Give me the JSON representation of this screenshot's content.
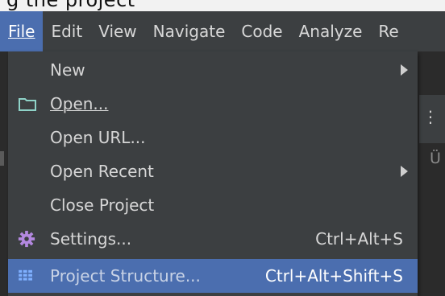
{
  "menubar": {
    "items": [
      {
        "label": "File",
        "active": true
      },
      {
        "label": "Edit"
      },
      {
        "label": "View"
      },
      {
        "label": "Navigate"
      },
      {
        "label": "Code"
      },
      {
        "label": "Analyze"
      },
      {
        "label": "Re"
      }
    ]
  },
  "background": {
    "top_cut_text": "g     the       project",
    "side_char": "Ü",
    "kebab": "⋮"
  },
  "file_menu": {
    "items": [
      {
        "label": "New",
        "submenu": true
      },
      {
        "label": "Open...",
        "icon": "folder-icon"
      },
      {
        "label": "Open URL..."
      },
      {
        "label": "Open Recent",
        "submenu": true
      },
      {
        "label": "Close Project"
      },
      {
        "label": "Settings...",
        "icon": "gear-icon",
        "shortcut": "Ctrl+Alt+S"
      },
      {
        "label": "Project Structure...",
        "icon": "grid-icon",
        "shortcut": "Ctrl+Alt+Shift+S",
        "selected": true
      }
    ]
  },
  "colors": {
    "menubar_bg": "#3c3f41",
    "active_bg": "#4b6eaf",
    "folder_icon": "#8fd3c8",
    "gear_icon": "#b388e0",
    "grid_icon": "#7fb0ff"
  }
}
